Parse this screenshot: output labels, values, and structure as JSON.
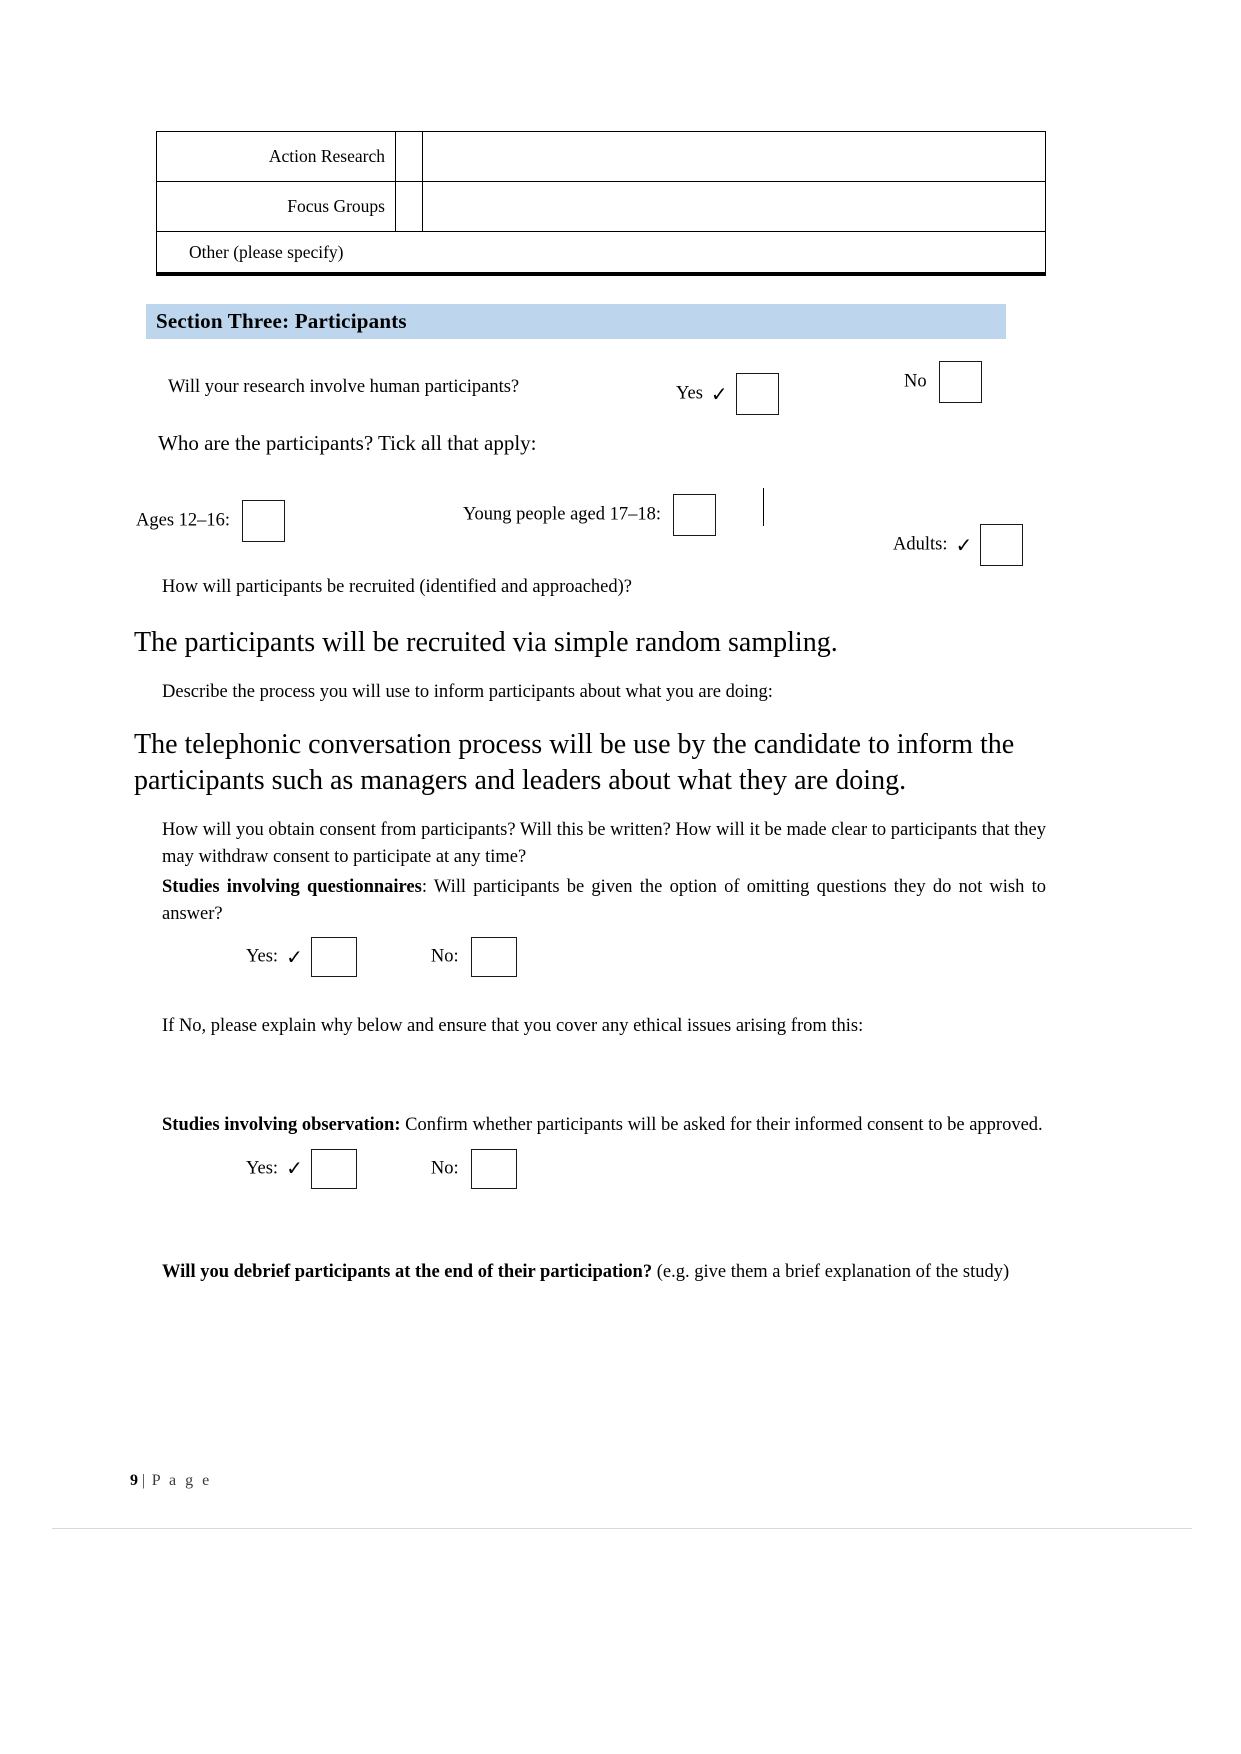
{
  "document": {
    "table": {
      "rows": [
        {
          "label": "Action Research",
          "tick": "",
          "fill": ""
        },
        {
          "label": "Focus Groups",
          "tick": "",
          "fill": ""
        }
      ],
      "other_row_label": "Other (please specify)"
    },
    "section": {
      "heading": "Section Three: Participants",
      "heading_bg": "#bdd6ee"
    },
    "human_participants": {
      "question": "Will your research involve human participants?",
      "yes_label": "Yes",
      "yes_tick": "✓",
      "no_label": "No",
      "no_tick": ""
    },
    "who": {
      "prompt": "Who are the participants? Tick all that apply:",
      "options": [
        {
          "label": "Ages 12–16:",
          "tick": ""
        },
        {
          "label": "Young people aged 17–18:",
          "tick": ""
        },
        {
          "label": "Adults:",
          "tick": "✓"
        }
      ]
    },
    "recruitment": {
      "question": "How will participants be recruited (identified and approached)?",
      "answer": "The participants will be recruited via simple random sampling."
    },
    "inform_process": {
      "question": "Describe the process you will use to inform participants about what you are doing:",
      "answer": "The telephonic conversation process will be use by the candidate to inform the participants such as managers and leaders about what they are doing."
    },
    "consent": {
      "question": "How will you obtain consent from participants? Will this be written? How will it be made clear to participants that they may withdraw consent to participate at any time?",
      "questionnaires_bold": "Studies involving questionnaires",
      "questionnaires_rest": ": Will participants be given the option of omitting questions they do not wish to answer?",
      "yes_label": "Yes:",
      "yes_tick": "✓",
      "no_label": "No:",
      "no_tick": "",
      "if_no_text": "If No, please explain why below and ensure that you cover any ethical issues arising from this:"
    },
    "observation": {
      "bold": "Studies involving observation:",
      "rest": " Confirm whether participants will be asked for their informed consent to be approved.",
      "yes_label": "Yes:",
      "yes_tick": "✓",
      "no_label": "No:",
      "no_tick": ""
    },
    "debrief": {
      "bold": "Will you debrief participants at the end of their participation?",
      "rest": " (e.g. give them a brief explanation of the study)"
    },
    "footer": {
      "page_number": "9",
      "separator": "|",
      "page_word": "P a g e"
    }
  }
}
